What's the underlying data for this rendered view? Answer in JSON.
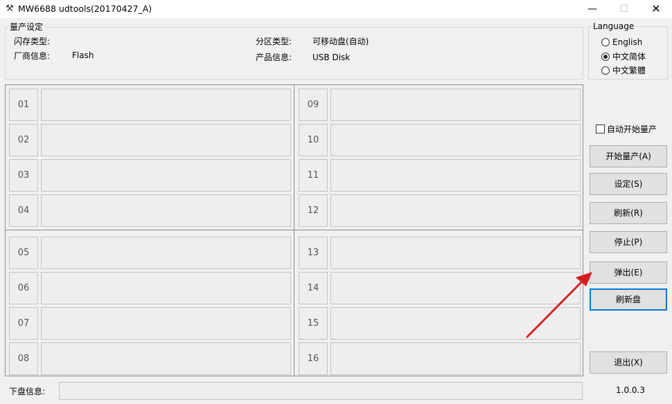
{
  "window": {
    "app_icon": "⚒",
    "title": "MW6688 udtools(20170427_A)",
    "min_glyph": "—",
    "max_glyph": "☐",
    "close_glyph": "✕"
  },
  "settings": {
    "legend": "量产设定",
    "flash_type_label": "闪存类型:",
    "flash_type_value": "",
    "vendor_label": "厂商信息:",
    "vendor_value": "Flash",
    "partition_label": "分区类型:",
    "partition_value": "可移动盘(自动)",
    "product_label": "产品信息:",
    "product_value": "USB Disk"
  },
  "language": {
    "legend": "Language",
    "options": [
      {
        "label": "English",
        "checked": false
      },
      {
        "label": "中文简体",
        "checked": true
      },
      {
        "label": "中文繁體",
        "checked": false
      }
    ]
  },
  "ports": [
    "01",
    "02",
    "03",
    "04",
    "05",
    "06",
    "07",
    "08",
    "09",
    "10",
    "11",
    "12",
    "13",
    "14",
    "15",
    "16"
  ],
  "auto_start": {
    "label": "自动开始量产",
    "checked": false
  },
  "buttons": {
    "start": "开始量产(A)",
    "settings": "设定(S)",
    "refresh": "刷新(R)",
    "stop": "停止(P)",
    "eject": "弹出(E)",
    "refresh_disk": "刷新盘",
    "exit": "退出(X)"
  },
  "bottom": {
    "disk_info_label": "下盘信息:",
    "version": "1.0.0.3"
  },
  "colors": {
    "annotation_arrow": "#d62020",
    "focus_border": "#0078d7"
  }
}
